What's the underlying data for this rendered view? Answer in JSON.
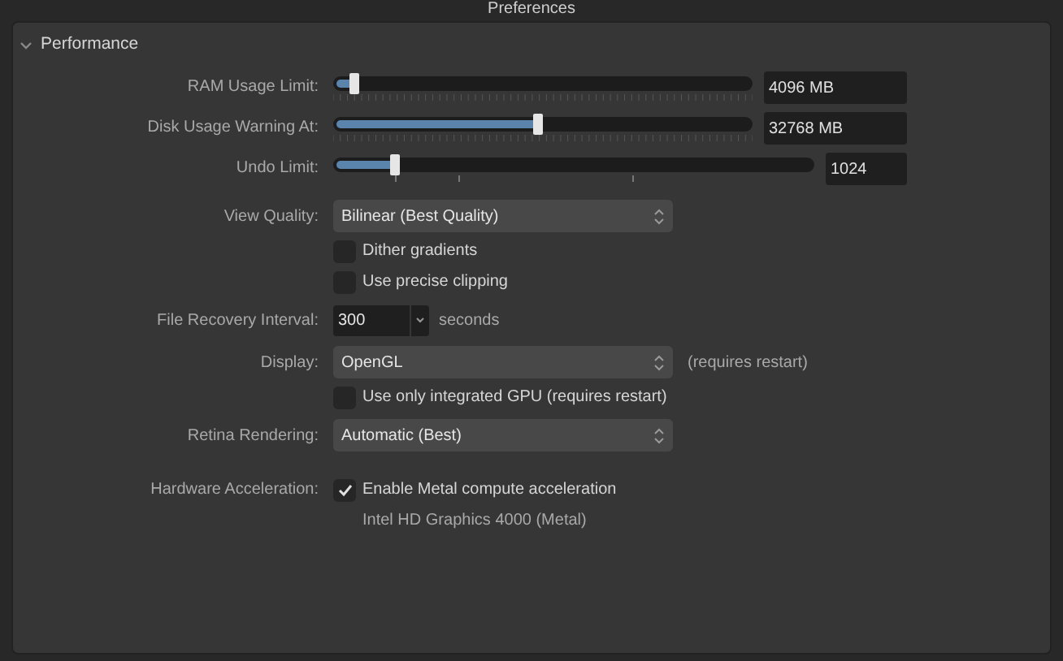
{
  "window": {
    "title": "Preferences"
  },
  "section": {
    "title": "Performance",
    "expanded": true
  },
  "rows": [
    {
      "kind": "slider",
      "label": "RAM Usage Limit:",
      "value": "4096 MB",
      "level": 0.05,
      "fine_ticks": true
    },
    {
      "kind": "slider",
      "label": "Disk Usage Warning At:",
      "value": "32768 MB",
      "level": 0.49,
      "fine_ticks": true
    },
    {
      "kind": "slider",
      "label": "Undo Limit:",
      "value": "1024",
      "level": 0.13,
      "fine_ticks": false
    },
    {
      "kind": "select",
      "label": "View Quality:",
      "value": "Bilinear (Best Quality)"
    },
    {
      "kind": "checkbox",
      "text": "Dither gradients",
      "checked": false
    },
    {
      "kind": "checkbox",
      "text": "Use precise clipping",
      "checked": false
    },
    {
      "kind": "combo",
      "label": "File Recovery Interval:",
      "value": "300",
      "suffix": "seconds"
    },
    {
      "kind": "select",
      "label": "Display:",
      "value": "OpenGL",
      "note": "(requires restart)"
    },
    {
      "kind": "checkbox",
      "text": "Use only integrated GPU (requires restart)",
      "checked": false
    },
    {
      "kind": "select",
      "label": "Retina Rendering:",
      "value": "Automatic (Best)"
    },
    {
      "kind": "checkbox",
      "label": "Hardware Acceleration:",
      "text": "Enable Metal compute acceleration",
      "checked": true
    },
    {
      "kind": "note",
      "text": "Intel HD Graphics 4000 (Metal)"
    }
  ]
}
